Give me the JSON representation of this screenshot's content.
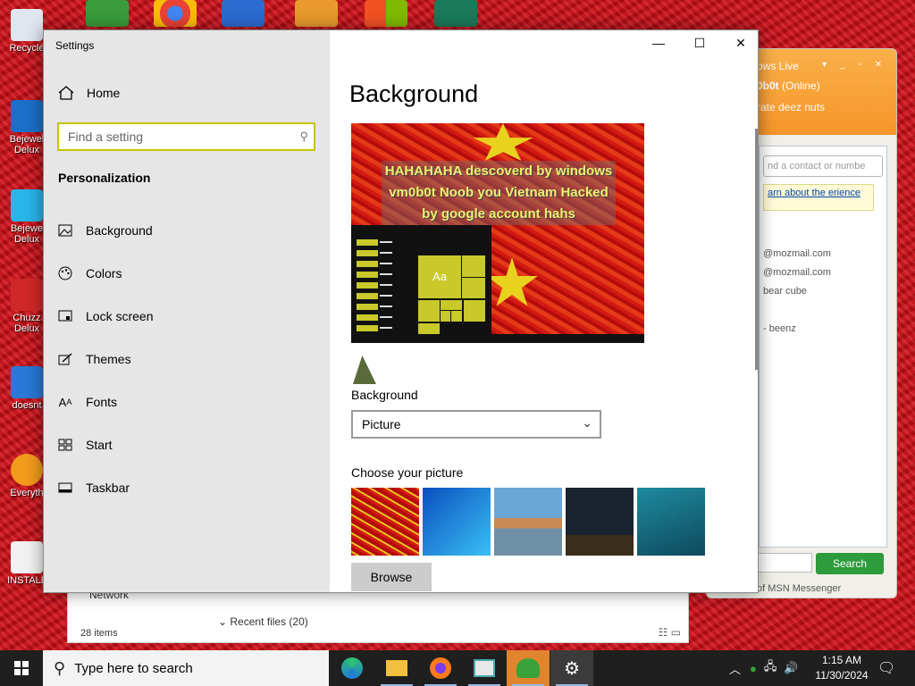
{
  "desktop": {
    "icons": [
      {
        "label": "Recycle"
      },
      {
        "label": "Bejewel Delux"
      },
      {
        "label": "Bejewe Delux"
      },
      {
        "label": "Chuzz Delux"
      },
      {
        "label": "doesnt"
      },
      {
        "label": "Everyth"
      },
      {
        "label": "INSTALL"
      }
    ]
  },
  "msn": {
    "title": "ows Live",
    "username": "0b0t",
    "status": "(Online)",
    "message": "rate deez nuts",
    "search_placeholder": "nd a contact or numbe",
    "info_text": "arn about the erience",
    "contacts": [
      "@mozmail.com",
      "@mozmail.com",
      "bear cube",
      "",
      "- beenz"
    ],
    "search_button": "Search",
    "footer": "of MSN Messenger"
  },
  "explorer": {
    "network_label": "Network",
    "recent_label": "Recent files (20)",
    "item_count": "28 items"
  },
  "settings": {
    "window_title": "Settings",
    "home_label": "Home",
    "search_placeholder": "Find a setting",
    "section_title": "Personalization",
    "nav": [
      {
        "label": "Background",
        "icon": "picture-icon"
      },
      {
        "label": "Colors",
        "icon": "palette-icon"
      },
      {
        "label": "Lock screen",
        "icon": "lock-screen-icon"
      },
      {
        "label": "Themes",
        "icon": "brush-icon"
      },
      {
        "label": "Fonts",
        "icon": "font-icon"
      },
      {
        "label": "Start",
        "icon": "start-grid-icon"
      },
      {
        "label": "Taskbar",
        "icon": "taskbar-icon"
      }
    ],
    "page_title": "Background",
    "preview_banner": "HAHAHAHA descoverd by windows vm0b0t Noob you Vietnam Hacked by google account hahs",
    "preview_tile_label": "Aa",
    "background_label": "Background",
    "background_value": "Picture",
    "choose_label": "Choose your picture",
    "browse_label": "Browse"
  },
  "taskbar": {
    "search_placeholder": "Type here to search",
    "time": "1:15 AM",
    "date": "11/30/2024"
  },
  "colors": {
    "accent": "#c9c92c",
    "search_border": "#c5c500",
    "desktop_red": "#c8101a"
  }
}
